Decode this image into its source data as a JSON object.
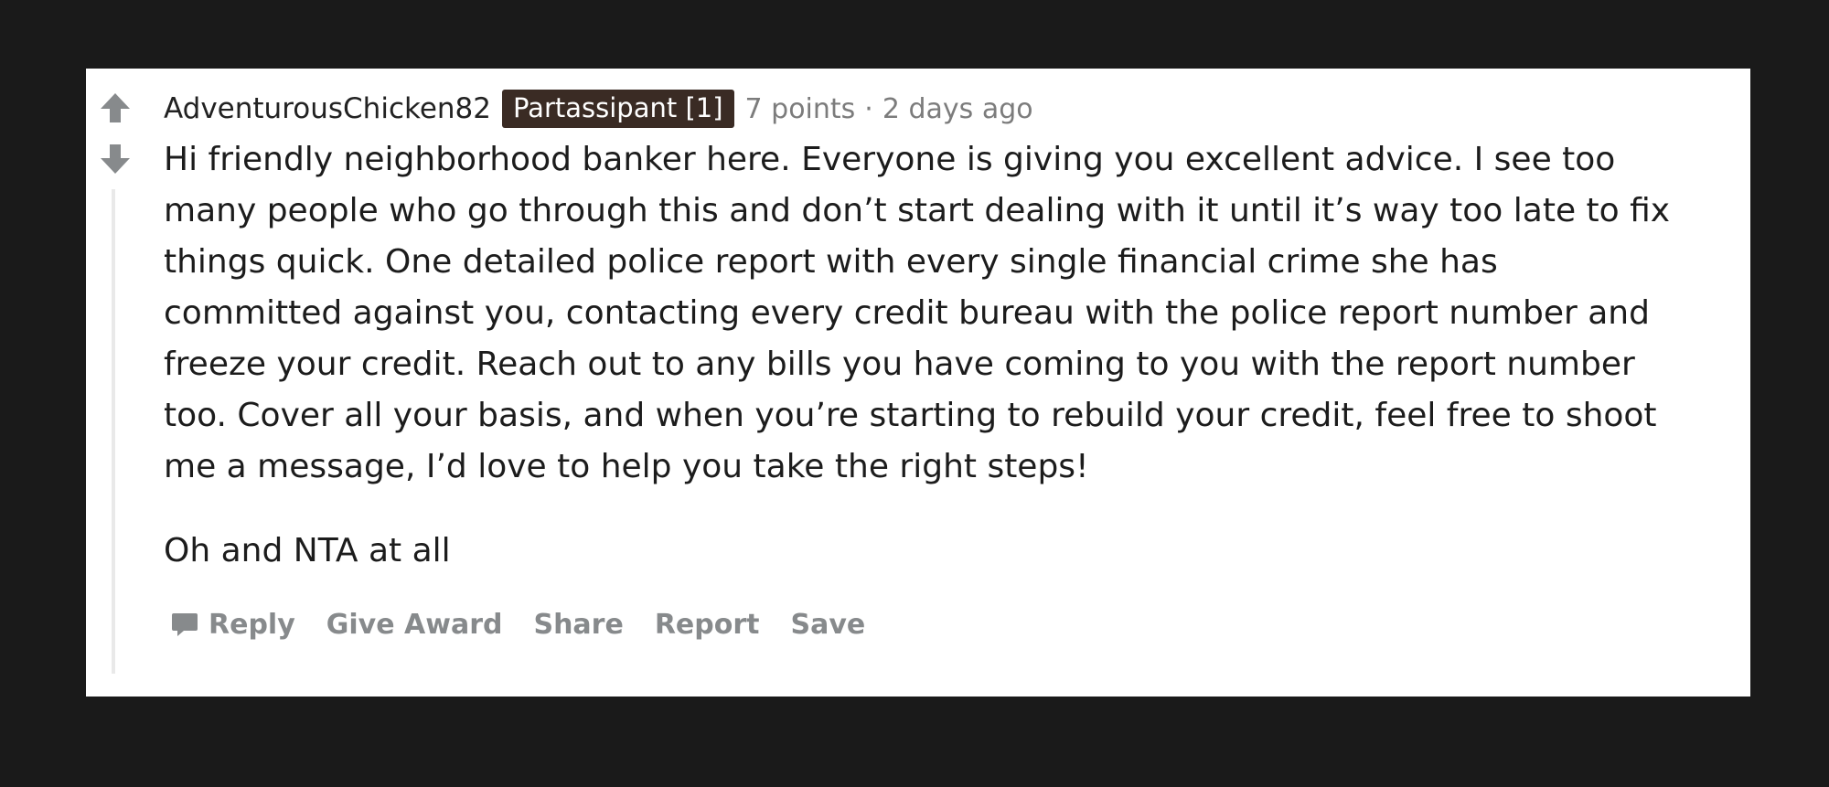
{
  "comment": {
    "author": "AdventurousChicken82",
    "flair": "Partassipant [1]",
    "points": "7 points",
    "separator": "·",
    "age": "2 days ago",
    "paragraphs": [
      "Hi friendly neighborhood banker here. Everyone is giving you excellent advice. I see too many people who go through this and don’t start dealing with it until it’s way too late to fix things quick. One detailed police report with every single financial crime she has committed against you, contacting every credit bureau with the police report number and freeze your credit. Reach out to any bills you have coming to you with the report number too. Cover all your basis, and when you’re starting to rebuild your credit, feel free to shoot me a message, I’d love to help you take the right steps!",
      "Oh and NTA at all"
    ]
  },
  "actions": {
    "reply": "Reply",
    "give_award": "Give Award",
    "share": "Share",
    "report": "Report",
    "save": "Save"
  },
  "icons": {
    "upvote": "arrow-up-icon",
    "downvote": "arrow-down-icon",
    "reply": "speech-bubble-icon"
  },
  "colors": {
    "background": "#1a1a1a",
    "card": "#ffffff",
    "flair_bg": "#3a2b24",
    "flair_text": "#ffffff",
    "meta": "#7c7c7c",
    "action": "#878a8c",
    "vote_arrow": "#878a8c",
    "text": "#1c1c1c"
  }
}
